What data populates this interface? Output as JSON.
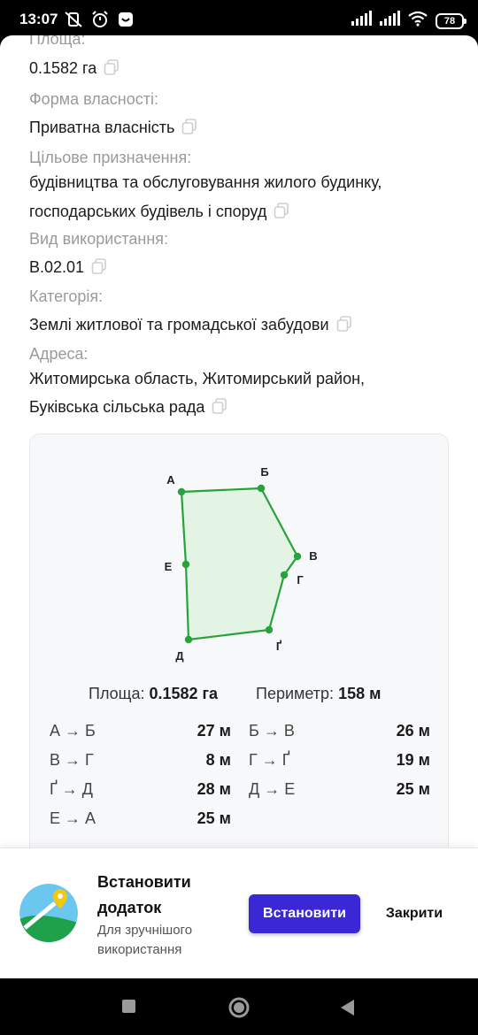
{
  "status_bar": {
    "time": "13:07",
    "battery": "78",
    "icons": [
      "vibrate-off-icon",
      "alarm-icon",
      "notification-icon",
      "signal-icon",
      "signal-icon",
      "wifi-icon",
      "battery-icon"
    ]
  },
  "fields": [
    {
      "label": "Площа:",
      "value": "0.1582 га"
    },
    {
      "label": "Форма власності:",
      "value": "Приватна власність"
    },
    {
      "label": "Цільове призначення:",
      "value_lines": [
        "будівництва та обслуговування жилого будинку,",
        "господарських будівель і споруд"
      ]
    },
    {
      "label": "Вид використання:",
      "value": "В.02.01"
    },
    {
      "label": "Категорія:",
      "value": "Землі житлової та громадської забудови"
    },
    {
      "label": "Адреса:",
      "value_lines": [
        "Житомирська область, Житомирський район,",
        "Буківська сільська рада"
      ]
    }
  ],
  "polygon": {
    "vertices": [
      {
        "label": "А"
      },
      {
        "label": "Б"
      },
      {
        "label": "В"
      },
      {
        "label": "Г"
      },
      {
        "label": "Ґ"
      },
      {
        "label": "Д"
      },
      {
        "label": "Е"
      }
    ],
    "colors": {
      "stroke": "#27a33a",
      "fill": "#e3f4e5",
      "point": "#27a33a"
    }
  },
  "summary": {
    "area_label": "Площа:",
    "area_value": "0.1582 га",
    "perimeter_label": "Периметр:",
    "perimeter_value": "158 м"
  },
  "sides": [
    {
      "name": "А → Б",
      "value": "27 м"
    },
    {
      "name": "Б → В",
      "value": "26 м"
    },
    {
      "name": "В → Г",
      "value": "8 м"
    },
    {
      "name": "Г → Ґ",
      "value": "19 м"
    },
    {
      "name": "Ґ → Д",
      "value": "28 м"
    },
    {
      "name": "Д → Е",
      "value": "25 м"
    },
    {
      "name": "Е → А",
      "value": "25 м"
    }
  ],
  "banner": {
    "title_line1": "Встановити",
    "title_line2": "додаток",
    "subtitle_line1": "Для зручнішого",
    "subtitle_line2": "використання",
    "install_label": "Встановити",
    "close_label": "Закрити",
    "accent_color": "#3a28d6"
  },
  "nav": {
    "buttons": [
      "recents-square-icon",
      "home-circle-icon",
      "back-triangle-icon"
    ]
  }
}
